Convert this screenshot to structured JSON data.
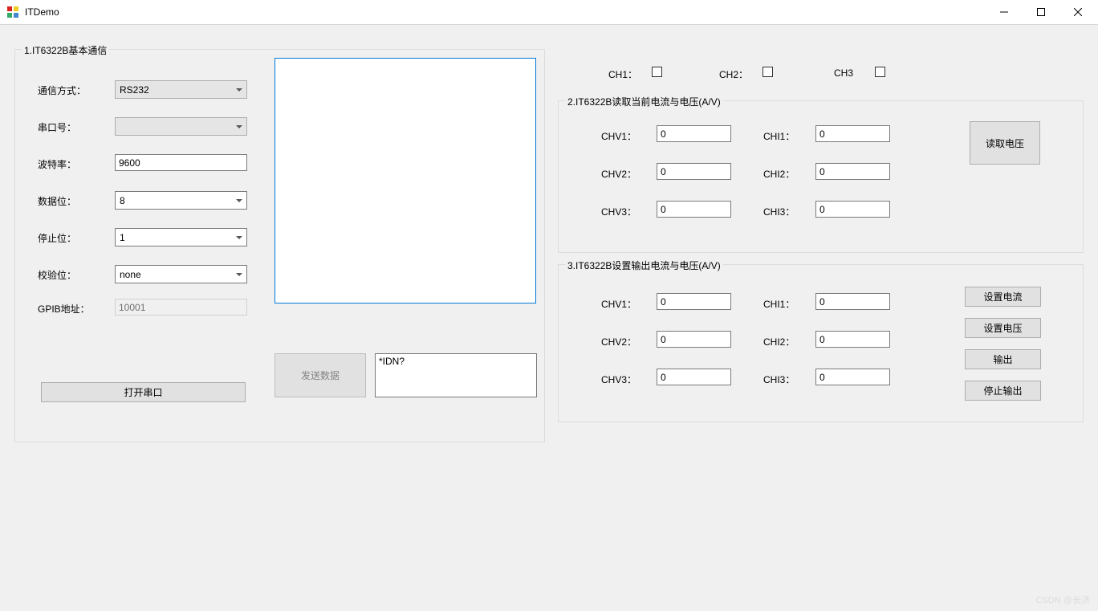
{
  "window": {
    "title": "ITDemo"
  },
  "section1": {
    "title": "1.IT6322B基本通信",
    "labels": {
      "comm_method": "通信方式：",
      "port": "串口号：",
      "baud": "波特率：",
      "data_bits": "数据位：",
      "stop_bits": "停止位：",
      "parity": "校验位：",
      "gpib": "GPIB地址："
    },
    "values": {
      "comm_method": "RS232",
      "port": "",
      "baud": "9600",
      "data_bits": "8",
      "stop_bits": "1",
      "parity": "none",
      "gpib": "10001"
    },
    "open_port_btn": "打开串口",
    "send_btn": "发送数据",
    "log_text": "",
    "cmd_text": "*IDN?"
  },
  "channels": {
    "ch1_label": "CH1：",
    "ch2_label": "CH2：",
    "ch3_label": "CH3"
  },
  "section2": {
    "title": "2.IT6322B读取当前电流与电压(A/V)",
    "labels": {
      "chv1": "CHV1：",
      "chi1": "CHI1：",
      "chv2": "CHV2：",
      "chi2": "CHI2：",
      "chv3": "CHV3：",
      "chi3": "CHI3："
    },
    "values": {
      "chv1": "0",
      "chi1": "0",
      "chv2": "0",
      "chi2": "0",
      "chv3": "0",
      "chi3": "0"
    },
    "read_btn": "读取电压"
  },
  "section3": {
    "title": "3.IT6322B设置输出电流与电压(A/V)",
    "labels": {
      "chv1": "CHV1：",
      "chi1": "CHI1：",
      "chv2": "CHV2：",
      "chi2": "CHI2：",
      "chv3": "CHV3：",
      "chi3": "CHI3："
    },
    "values": {
      "chv1": "0",
      "chi1": "0",
      "chv2": "0",
      "chi2": "0",
      "chv3": "0",
      "chi3": "0"
    },
    "set_current_btn": "设置电流",
    "set_voltage_btn": "设置电压",
    "output_btn": "输出",
    "stop_output_btn": "停止输出"
  },
  "watermark": "CSDN @长济"
}
